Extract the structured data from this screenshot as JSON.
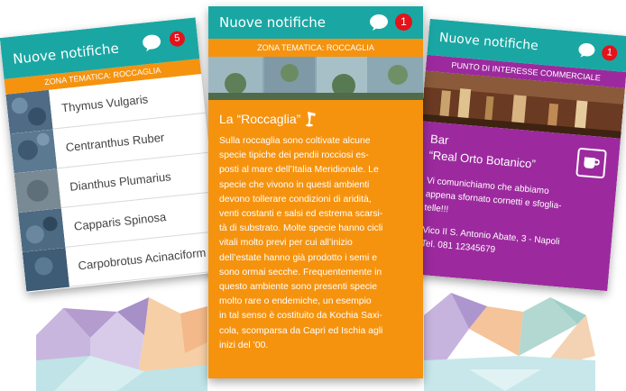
{
  "left_card": {
    "title": "Nuove notifiche",
    "badge": "5",
    "subtitle": "ZONA TEMATICA: ROCCAGLIA",
    "items": [
      {
        "label": "Thymus Vulgaris"
      },
      {
        "label": "Centranthus Ruber"
      },
      {
        "label": "Dianthus Plumarius"
      },
      {
        "label": "Capparis Spinosa"
      },
      {
        "label": "Carpobrotus Acinaciform"
      }
    ]
  },
  "center_card": {
    "title": "Nuove notifiche",
    "badge": "1",
    "subtitle": "ZONA TEMATICA: ROCCAGLIA",
    "heading": "La “Roccaglia”",
    "body_lines": [
      "Sulla roccaglia sono coltivate alcune",
      "specie tipiche dei pendii rocciosi es-",
      "posti al mare dell’Italia Meridionale. Le",
      "specie che vivono in questi ambienti",
      "devono tollerare condizioni di aridità,",
      "venti costanti e salsi ed estrema scarsi-",
      "tà di substrato. Molte specie hanno cicli",
      "vitali molto previ per cui all’inizio",
      "dell’estate hanno già prodotto i semi e",
      "sono ormai secche. Frequentemente in",
      "questo ambiente sono presenti specie",
      "molto rare o endemiche, un esempio",
      "in tal senso è costituito da Kochia Saxi-",
      "cola, scomparsa da Capri ed Ischia agli",
      "inizi del ’00."
    ]
  },
  "right_card": {
    "title": "Nuove notifiche",
    "badge": "1",
    "subtitle": "PUNTO DI INTERESSE COMMERCIALE",
    "name_line1": "Bar",
    "name_line2": "“Real Orto Botanico”",
    "message_lines": [
      "Vi comunichiamo che abbiamo",
      "appena sfornato cornetti e sfoglia-",
      "telle!!!"
    ],
    "address_lines": [
      "Vico II S. Antonio Abate, 3 - Napoli",
      "Tel. 081 12345679"
    ]
  },
  "colors": {
    "teal": "#1aa7a3",
    "orange": "#f5930f",
    "purple": "#9c2a9e",
    "badge_red": "#e3121b"
  },
  "icons": {
    "chat": "chat-bubble-icon",
    "badge": "notification-count",
    "plant_pin": "plant-pin-icon",
    "coffee": "coffee-cup-icon"
  }
}
